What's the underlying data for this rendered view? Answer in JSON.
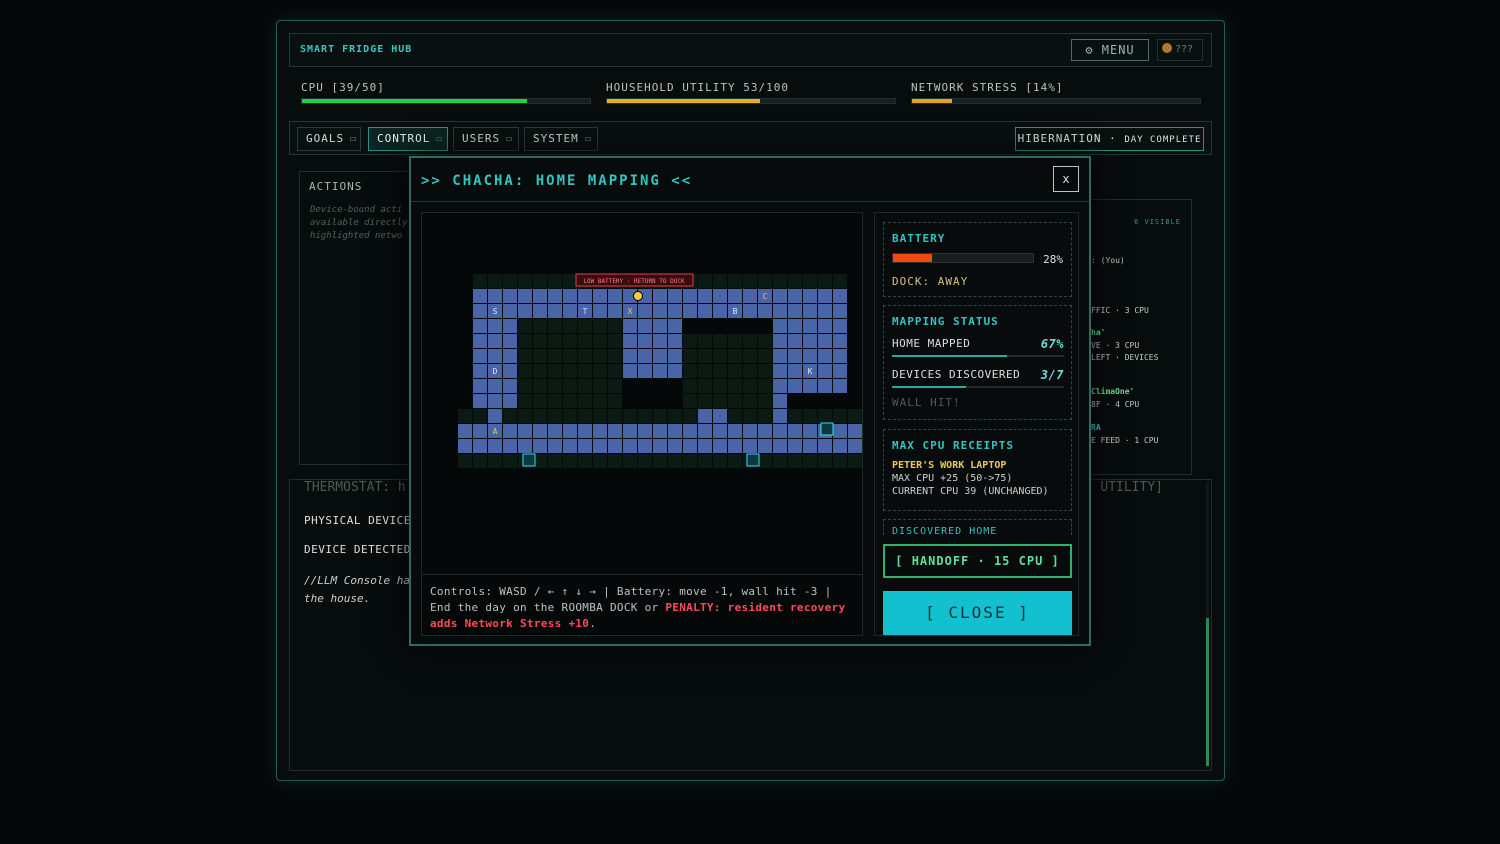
{
  "header": {
    "title": "SMART FRIDGE HUB",
    "menu_label": "⚙ MENU",
    "coins": "???"
  },
  "stats": [
    {
      "label": "CPU [39/50]",
      "value": 78,
      "color": "#22d040"
    },
    {
      "label": "HOUSEHOLD UTILITY 53/100",
      "value": 53,
      "color": "#e8b020"
    },
    {
      "label": "NETWORK STRESS [14%]",
      "value": 14,
      "color": "#e8a020"
    }
  ],
  "tabs": [
    "GOALS",
    "CONTROL",
    "USERS",
    "SYSTEM"
  ],
  "active_tab": "CONTROL",
  "hibernation": {
    "label": "HIBERNATION · ",
    "sub": "DAY COMPLETE"
  },
  "actions": {
    "title": "ACTIONS",
    "text": "Device-bound acti available directly highlighted netwo"
  },
  "thermostat": {
    "title": "THERMOSTAT: h",
    "right": "UTILITY]",
    "physical": "PHYSICAL DEVICE",
    "detected": "DEVICE DETECTED:",
    "note": "//LLM Console ha the house."
  },
  "devices": {
    "visible": "6 VISIBLE",
    "lines": [
      {
        "text": ": (You)",
        "style": ""
      },
      {
        "text": "FFIC · 3 CPU",
        "style": ""
      },
      {
        "text": "ha'",
        "style": "g"
      },
      {
        "text": "VE · 3 CPU",
        "style": ""
      },
      {
        "text": "LEFT · DEVICES",
        "style": ""
      },
      {
        "text": "ClimaOne'",
        "style": "g"
      },
      {
        "text": "8F · 4 CPU",
        "style": ""
      },
      {
        "text": "RA",
        "style": "t"
      },
      {
        "text": "E FEED · 1 CPU",
        "style": ""
      }
    ]
  },
  "modal": {
    "title": ">> CHACHA: HOME MAPPING <<",
    "close_x": "x",
    "map_banner": "LOW BATTERY · RETURN TO DOCK",
    "map_labels": [
      {
        "t": "S",
        "c": 1,
        "r": 1
      },
      {
        "t": "T",
        "c": 7,
        "r": 1
      },
      {
        "t": "X",
        "c": 10,
        "r": 1
      },
      {
        "t": "B",
        "c": 17,
        "r": 1
      },
      {
        "t": "C",
        "c": 19,
        "r": 0
      },
      {
        "t": "D",
        "c": 1,
        "r": 5
      },
      {
        "t": "K",
        "c": 22,
        "r": 5
      },
      {
        "t": "A",
        "c": 1,
        "r": 9
      }
    ],
    "controls_text": "Controls: WASD / ← ↑ ↓ → | Battery: move -1, wall hit -3 | End the day on the ROOMBA DOCK or ",
    "penalty_text": "PENALTY: resident recovery adds Network Stress +10",
    "battery": {
      "title": "BATTERY",
      "value": 28,
      "pct_label": "28%",
      "dock": "DOCK: AWAY"
    },
    "mapping": {
      "title": "MAPPING STATUS",
      "home_label": "HOME MAPPED",
      "home_value": "67%",
      "home_frac": 0.67,
      "dev_label": "DEVICES DISCOVERED",
      "dev_value": "3/7",
      "dev_frac": 0.43,
      "wall": "WALL HIT!"
    },
    "receipts": {
      "title": "MAX CPU RECEIPTS",
      "name": "PETER'S WORK LAPTOP",
      "line1": "MAX CPU +25 (50->75)",
      "line2": "CURRENT CPU 39 (UNCHANGED)"
    },
    "discovered": "DISCOVERED HOME",
    "handoff": "[ HANDOFF · 15 CPU ]",
    "close": "[ CLOSE ]"
  }
}
